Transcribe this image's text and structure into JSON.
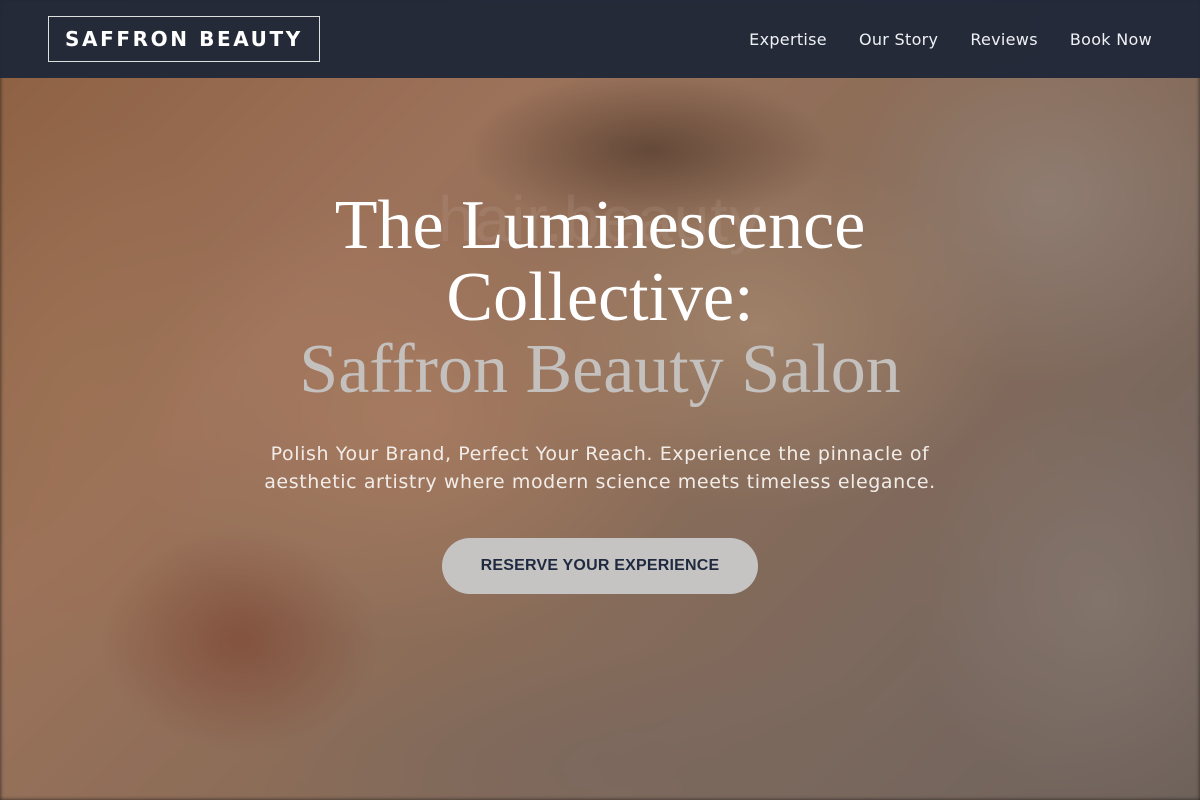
{
  "nav": {
    "brand": "SAFFRON BEAUTY",
    "links": [
      "Expertise",
      "Our Story",
      "Reviews",
      "Book Now"
    ]
  },
  "hero": {
    "title_line1": "The Luminescence",
    "title_line2": "Collective:",
    "title_line3": "Saffron Beauty Salon",
    "watermark": "hair.beauty",
    "subtitle": "Polish Your Brand, Perfect Your Reach. Experience the pinnacle of aesthetic artistry where modern science meets timeless elegance.",
    "cta_label": "RESERVE YOUR EXPERIENCE"
  },
  "colors": {
    "navbar": "#202838",
    "cta_background": "#c6c4c3",
    "cta_text": "#1f2a40"
  }
}
